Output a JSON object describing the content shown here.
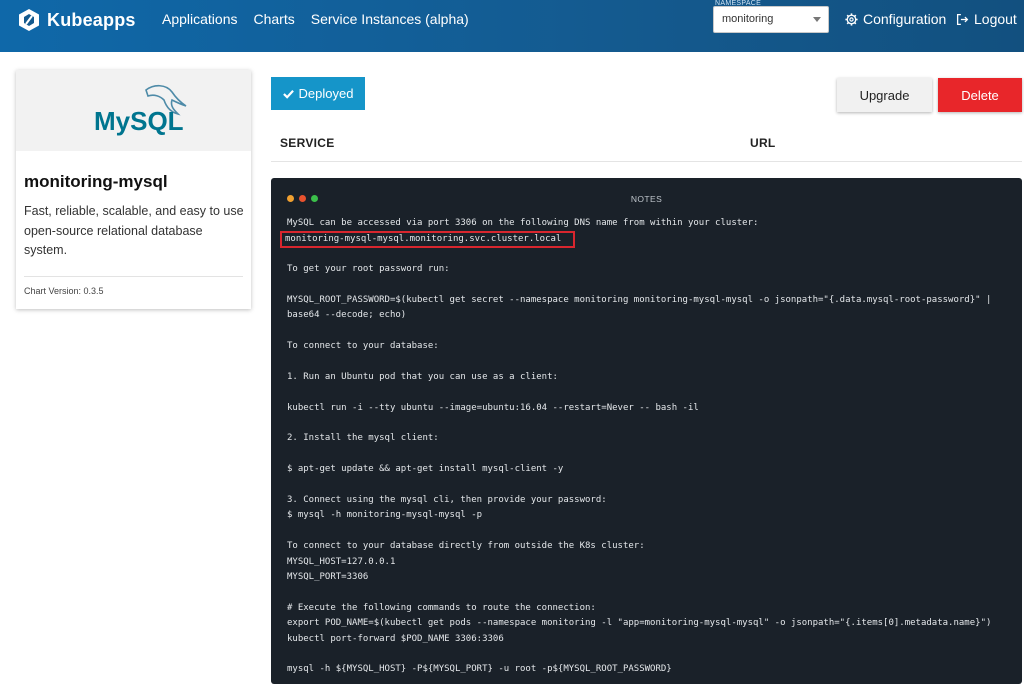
{
  "app": {
    "name": "Kubeapps"
  },
  "nav": {
    "items": [
      "Applications",
      "Charts",
      "Service Instances (alpha)"
    ]
  },
  "namespace": {
    "label": "NAMESPACE",
    "value": "monitoring"
  },
  "header_actions": {
    "configuration": "Configuration",
    "logout": "Logout"
  },
  "card": {
    "title": "monitoring-mysql",
    "description": "Fast, reliable, scalable, and easy to use open-source relational database system.",
    "chart_version": "Chart Version: 0.3.5",
    "logo_text": "MySQL"
  },
  "status": {
    "label": "Deployed"
  },
  "actions": {
    "upgrade": "Upgrade",
    "delete": "Delete"
  },
  "table": {
    "headers": [
      "SERVICE",
      "URL"
    ]
  },
  "notes": {
    "title": "NOTES",
    "lines": [
      "MySQL can be accessed via port 3306 on the following DNS name from within your cluster:",
      "monitoring-mysql-mysql.monitoring.svc.cluster.local",
      "",
      "To get your root password run:",
      "",
      "MYSQL_ROOT_PASSWORD=$(kubectl get secret --namespace monitoring monitoring-mysql-mysql -o jsonpath=\"{.data.mysql-root-password}\" |",
      "base64 --decode; echo)",
      "",
      "To connect to your database:",
      "",
      "1. Run an Ubuntu pod that you can use as a client:",
      "",
      "kubectl run -i --tty ubuntu --image=ubuntu:16.04 --restart=Never -- bash -il",
      "",
      "2. Install the mysql client:",
      "",
      "$ apt-get update && apt-get install mysql-client -y",
      "",
      "3. Connect using the mysql cli, then provide your password:",
      "$ mysql -h monitoring-mysql-mysql -p",
      "",
      "To connect to your database directly from outside the K8s cluster:",
      "MYSQL_HOST=127.0.0.1",
      "MYSQL_PORT=3306",
      "",
      "# Execute the following commands to route the connection:",
      "export POD_NAME=$(kubectl get pods --namespace monitoring -l \"app=monitoring-mysql-mysql\" -o jsonpath=\"{.items[0].metadata.name}\")",
      "kubectl port-forward $POD_NAME 3306:3306",
      "",
      "mysql -h ${MYSQL_HOST} -P${MYSQL_PORT} -u root -p${MYSQL_ROOT_PASSWORD}"
    ],
    "highlighted_line_index": 1,
    "dot_colors": [
      "#f0a030",
      "#e8522e",
      "#3bbf4a"
    ]
  },
  "colors": {
    "header": "#145a8f",
    "deployed": "#1595c9",
    "delete": "#e8262a",
    "notes_bg": "#1a2129",
    "highlight_border": "#d8262e"
  }
}
